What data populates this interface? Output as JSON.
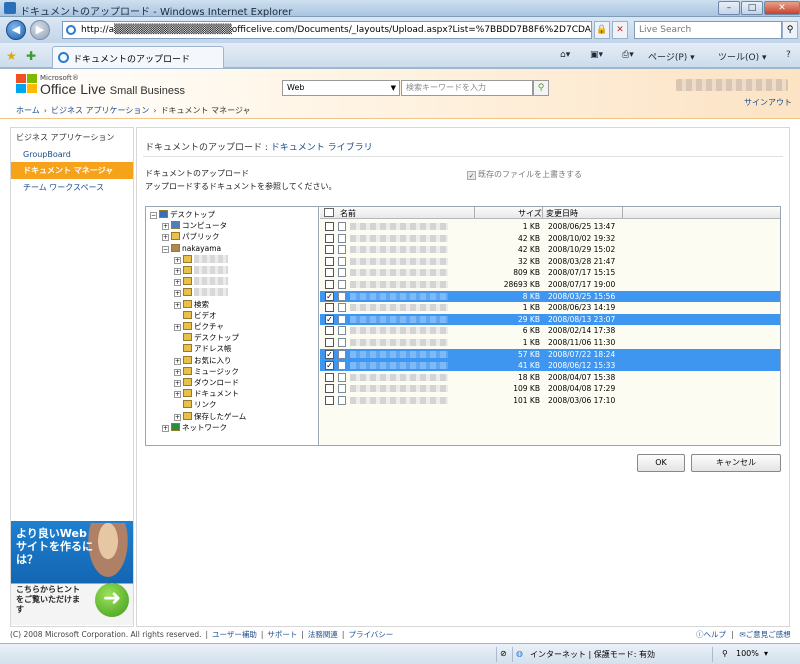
{
  "window": {
    "title": "ドキュメントのアップロード - Windows Internet Explorer",
    "min": "–",
    "max": "□",
    "close": "✕"
  },
  "address": {
    "url": "http://a▒▒▒▒▒▒▒▒▒▒▒▒▒▒▒▒▒officelive.com/Documents/_layouts/Upload.aspx?List=%7BBDD7B8F6%2D7CDA%2D490D%",
    "live_search_placeholder": "Live Search"
  },
  "tab": {
    "label": "ドキュメントのアップロード"
  },
  "toolbar": {
    "page": "ページ(P) ▾",
    "tools": "ツール(O) ▾",
    "help": "?"
  },
  "site": {
    "ms_label": "Microsoft®",
    "brand": "Office Live",
    "brand_small": "Small Business",
    "search_scope": "Web",
    "search_placeholder": "検索キーワードを入力",
    "signout": "サインアウト",
    "breadcrumb": {
      "home": "ホーム",
      "apps": "ビジネス アプリケーション",
      "current": "ドキュメント マネージャ",
      "sep": "›"
    }
  },
  "sidebar": {
    "heading": "ビジネス アプリケーション",
    "items": [
      {
        "label": "GroupBoard"
      },
      {
        "label": "ドキュメント マネージャ"
      },
      {
        "label": "チーム ワークスペース"
      }
    ],
    "promo": {
      "title": "より良いWebサイトを作るには？",
      "body": "こちらからヒントをご覧いただけます"
    }
  },
  "main": {
    "title_prefix": "ドキュメントのアップロード : ",
    "title_lib": "ドキュメント ライブラリ",
    "section_label": "ドキュメントのアップロード",
    "instructions": "アップロードするドキュメントを参照してください。",
    "overwrite_label": "既存のファイルを上書きする",
    "ok": "OK",
    "cancel": "キャンセル"
  },
  "tree": [
    {
      "label": "デスクトップ",
      "pm": "−",
      "icon": "desktop-icon"
    },
    {
      "label": "コンピュータ",
      "pm": "+",
      "icon": "computer-icon"
    },
    {
      "label": "パブリック",
      "pm": "+",
      "icon": "folder-icon"
    },
    {
      "label": "nakayama",
      "pm": "−",
      "icon": "user-folder-icon"
    },
    {
      "label": "",
      "pm": "+",
      "icon": "folder-icon",
      "blur": true
    },
    {
      "label": "",
      "pm": "+",
      "icon": "folder-icon",
      "blur": true
    },
    {
      "label": "",
      "pm": "+",
      "icon": "folder-icon",
      "blur": true
    },
    {
      "label": "",
      "pm": "+",
      "icon": "folder-icon",
      "blur": true
    },
    {
      "label": "検索",
      "pm": "+",
      "icon": "search-folder-icon"
    },
    {
      "label": "ビデオ",
      "pm": "",
      "icon": "video-folder-icon"
    },
    {
      "label": "ピクチャ",
      "pm": "+",
      "icon": "pictures-folder-icon"
    },
    {
      "label": "デスクトップ",
      "pm": "",
      "icon": "desktop-folder-icon"
    },
    {
      "label": "アドレス帳",
      "pm": "",
      "icon": "contacts-folder-icon"
    },
    {
      "label": "お気に入り",
      "pm": "+",
      "icon": "favorites-folder-icon"
    },
    {
      "label": "ミュージック",
      "pm": "+",
      "icon": "music-folder-icon"
    },
    {
      "label": "ダウンロード",
      "pm": "+",
      "icon": "downloads-folder-icon"
    },
    {
      "label": "ドキュメント",
      "pm": "+",
      "icon": "documents-folder-icon"
    },
    {
      "label": "リンク",
      "pm": "",
      "icon": "links-folder-icon"
    },
    {
      "label": "保存したゲーム",
      "pm": "+",
      "icon": "saved-games-folder-icon"
    },
    {
      "label": "ネットワーク",
      "pm": "+",
      "icon": "network-icon"
    }
  ],
  "files": {
    "headers": {
      "name": "名前",
      "size": "サイズ",
      "modified": "変更日時"
    },
    "rows": [
      {
        "size": "1 KB",
        "date": "2008/06/25 13:47",
        "checked": false,
        "selected": false
      },
      {
        "size": "42 KB",
        "date": "2008/10/02 19:32",
        "checked": false,
        "selected": false
      },
      {
        "size": "42 KB",
        "date": "2008/10/29 15:02",
        "checked": false,
        "selected": false
      },
      {
        "size": "32 KB",
        "date": "2008/03/28 21:47",
        "checked": false,
        "selected": false
      },
      {
        "size": "809 KB",
        "date": "2008/07/17 15:15",
        "checked": false,
        "selected": false
      },
      {
        "size": "28693 KB",
        "date": "2008/07/17 19:00",
        "checked": false,
        "selected": false
      },
      {
        "size": "8 KB",
        "date": "2008/03/25 15:56",
        "checked": true,
        "selected": true
      },
      {
        "size": "1 KB",
        "date": "2008/06/23 14:19",
        "checked": false,
        "selected": false
      },
      {
        "size": "29 KB",
        "date": "2008/08/13 23:07",
        "checked": true,
        "selected": true
      },
      {
        "size": "6 KB",
        "date": "2008/02/14 17:38",
        "checked": false,
        "selected": false
      },
      {
        "size": "1 KB",
        "date": "2008/11/06 11:30",
        "checked": false,
        "selected": false
      },
      {
        "size": "57 KB",
        "date": "2008/07/22 18:24",
        "checked": true,
        "selected": true
      },
      {
        "size": "41 KB",
        "date": "2008/06/12 15:33",
        "checked": true,
        "selected": true
      },
      {
        "size": "18 KB",
        "date": "2008/04/07 15:38",
        "checked": false,
        "selected": false
      },
      {
        "size": "109 KB",
        "date": "2008/04/08 17:29",
        "checked": false,
        "selected": false
      },
      {
        "size": "101 KB",
        "date": "2008/03/06 17:10",
        "checked": false,
        "selected": false
      }
    ]
  },
  "footer": {
    "copyright": "(C) 2008 Microsoft Corporation. All rights reserved.",
    "links": [
      "ユーザー補助",
      "サポート",
      "法務関連",
      "プライバシー"
    ],
    "help": "ヘルプ",
    "feedback": "ご意見ご感想"
  },
  "status": {
    "zone": "インターネット | 保護モード: 有効",
    "zoom": "100%"
  },
  "colors": {
    "accent": "#f7a21b",
    "link": "#1a4c8b",
    "selection": "#3e96f0"
  }
}
